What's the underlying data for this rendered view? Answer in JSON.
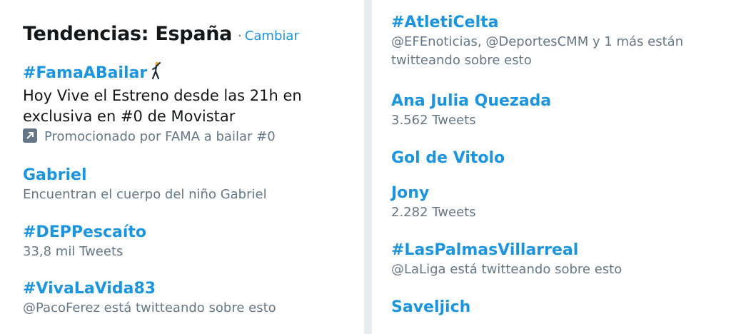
{
  "header": {
    "title": "Tendencias: España",
    "separator": "·",
    "change_label": "Cambiar"
  },
  "left_trends": [
    {
      "name": "#FamaABailar",
      "icon": "dancer-icon",
      "description": "Hoy Vive el Estreno desde las 21h en exclusiva en #0 de Movistar",
      "promoted": "Promocionado por FAMA a bailar #0"
    },
    {
      "name": "Gabriel",
      "meta": "Encuentran el cuerpo del niño Gabriel"
    },
    {
      "name": "#DEPPescaíto",
      "meta": "33,8 mil Tweets"
    },
    {
      "name": "#VivaLaVida83",
      "meta": "@PacoFerez está twitteando sobre esto"
    }
  ],
  "right_trends": [
    {
      "name": "#AtletiCelta",
      "meta": "@EFEnoticias, @DeportesCMM y 1 más están twitteando sobre esto"
    },
    {
      "name": "Ana Julia Quezada",
      "meta": "3.562 Tweets"
    },
    {
      "name": "Gol de Vitolo"
    },
    {
      "name": "Jony",
      "meta": "2.282 Tweets"
    },
    {
      "name": "#LasPalmasVillarreal",
      "meta": "@LaLiga está twitteando sobre esto"
    },
    {
      "name": "Saveljich"
    }
  ],
  "colors": {
    "link": "#1b95e0",
    "text": "#14171a",
    "muted": "#657786",
    "background": "#e6ecf0"
  }
}
